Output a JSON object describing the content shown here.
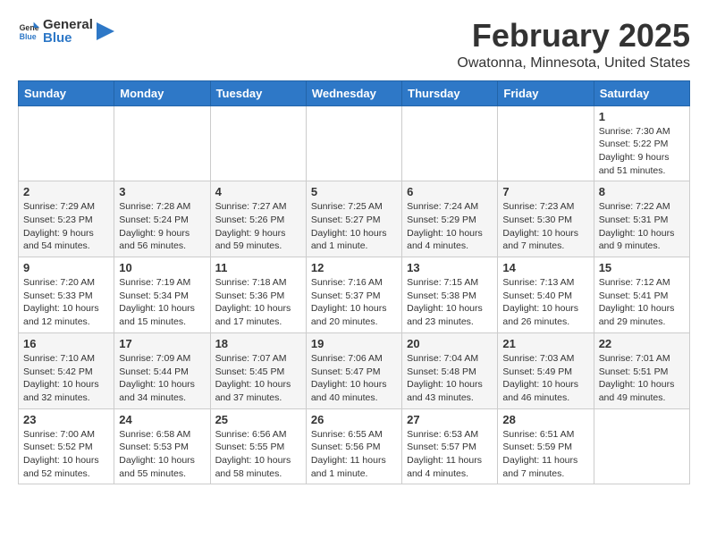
{
  "header": {
    "logo_general": "General",
    "logo_blue": "Blue",
    "title": "February 2025",
    "subtitle": "Owatonna, Minnesota, United States"
  },
  "weekdays": [
    "Sunday",
    "Monday",
    "Tuesday",
    "Wednesday",
    "Thursday",
    "Friday",
    "Saturday"
  ],
  "weeks": [
    [
      {
        "day": "",
        "info": ""
      },
      {
        "day": "",
        "info": ""
      },
      {
        "day": "",
        "info": ""
      },
      {
        "day": "",
        "info": ""
      },
      {
        "day": "",
        "info": ""
      },
      {
        "day": "",
        "info": ""
      },
      {
        "day": "1",
        "info": "Sunrise: 7:30 AM\nSunset: 5:22 PM\nDaylight: 9 hours\nand 51 minutes."
      }
    ],
    [
      {
        "day": "2",
        "info": "Sunrise: 7:29 AM\nSunset: 5:23 PM\nDaylight: 9 hours\nand 54 minutes."
      },
      {
        "day": "3",
        "info": "Sunrise: 7:28 AM\nSunset: 5:24 PM\nDaylight: 9 hours\nand 56 minutes."
      },
      {
        "day": "4",
        "info": "Sunrise: 7:27 AM\nSunset: 5:26 PM\nDaylight: 9 hours\nand 59 minutes."
      },
      {
        "day": "5",
        "info": "Sunrise: 7:25 AM\nSunset: 5:27 PM\nDaylight: 10 hours\nand 1 minute."
      },
      {
        "day": "6",
        "info": "Sunrise: 7:24 AM\nSunset: 5:29 PM\nDaylight: 10 hours\nand 4 minutes."
      },
      {
        "day": "7",
        "info": "Sunrise: 7:23 AM\nSunset: 5:30 PM\nDaylight: 10 hours\nand 7 minutes."
      },
      {
        "day": "8",
        "info": "Sunrise: 7:22 AM\nSunset: 5:31 PM\nDaylight: 10 hours\nand 9 minutes."
      }
    ],
    [
      {
        "day": "9",
        "info": "Sunrise: 7:20 AM\nSunset: 5:33 PM\nDaylight: 10 hours\nand 12 minutes."
      },
      {
        "day": "10",
        "info": "Sunrise: 7:19 AM\nSunset: 5:34 PM\nDaylight: 10 hours\nand 15 minutes."
      },
      {
        "day": "11",
        "info": "Sunrise: 7:18 AM\nSunset: 5:36 PM\nDaylight: 10 hours\nand 17 minutes."
      },
      {
        "day": "12",
        "info": "Sunrise: 7:16 AM\nSunset: 5:37 PM\nDaylight: 10 hours\nand 20 minutes."
      },
      {
        "day": "13",
        "info": "Sunrise: 7:15 AM\nSunset: 5:38 PM\nDaylight: 10 hours\nand 23 minutes."
      },
      {
        "day": "14",
        "info": "Sunrise: 7:13 AM\nSunset: 5:40 PM\nDaylight: 10 hours\nand 26 minutes."
      },
      {
        "day": "15",
        "info": "Sunrise: 7:12 AM\nSunset: 5:41 PM\nDaylight: 10 hours\nand 29 minutes."
      }
    ],
    [
      {
        "day": "16",
        "info": "Sunrise: 7:10 AM\nSunset: 5:42 PM\nDaylight: 10 hours\nand 32 minutes."
      },
      {
        "day": "17",
        "info": "Sunrise: 7:09 AM\nSunset: 5:44 PM\nDaylight: 10 hours\nand 34 minutes."
      },
      {
        "day": "18",
        "info": "Sunrise: 7:07 AM\nSunset: 5:45 PM\nDaylight: 10 hours\nand 37 minutes."
      },
      {
        "day": "19",
        "info": "Sunrise: 7:06 AM\nSunset: 5:47 PM\nDaylight: 10 hours\nand 40 minutes."
      },
      {
        "day": "20",
        "info": "Sunrise: 7:04 AM\nSunset: 5:48 PM\nDaylight: 10 hours\nand 43 minutes."
      },
      {
        "day": "21",
        "info": "Sunrise: 7:03 AM\nSunset: 5:49 PM\nDaylight: 10 hours\nand 46 minutes."
      },
      {
        "day": "22",
        "info": "Sunrise: 7:01 AM\nSunset: 5:51 PM\nDaylight: 10 hours\nand 49 minutes."
      }
    ],
    [
      {
        "day": "23",
        "info": "Sunrise: 7:00 AM\nSunset: 5:52 PM\nDaylight: 10 hours\nand 52 minutes."
      },
      {
        "day": "24",
        "info": "Sunrise: 6:58 AM\nSunset: 5:53 PM\nDaylight: 10 hours\nand 55 minutes."
      },
      {
        "day": "25",
        "info": "Sunrise: 6:56 AM\nSunset: 5:55 PM\nDaylight: 10 hours\nand 58 minutes."
      },
      {
        "day": "26",
        "info": "Sunrise: 6:55 AM\nSunset: 5:56 PM\nDaylight: 11 hours\nand 1 minute."
      },
      {
        "day": "27",
        "info": "Sunrise: 6:53 AM\nSunset: 5:57 PM\nDaylight: 11 hours\nand 4 minutes."
      },
      {
        "day": "28",
        "info": "Sunrise: 6:51 AM\nSunset: 5:59 PM\nDaylight: 11 hours\nand 7 minutes."
      },
      {
        "day": "",
        "info": ""
      }
    ]
  ]
}
